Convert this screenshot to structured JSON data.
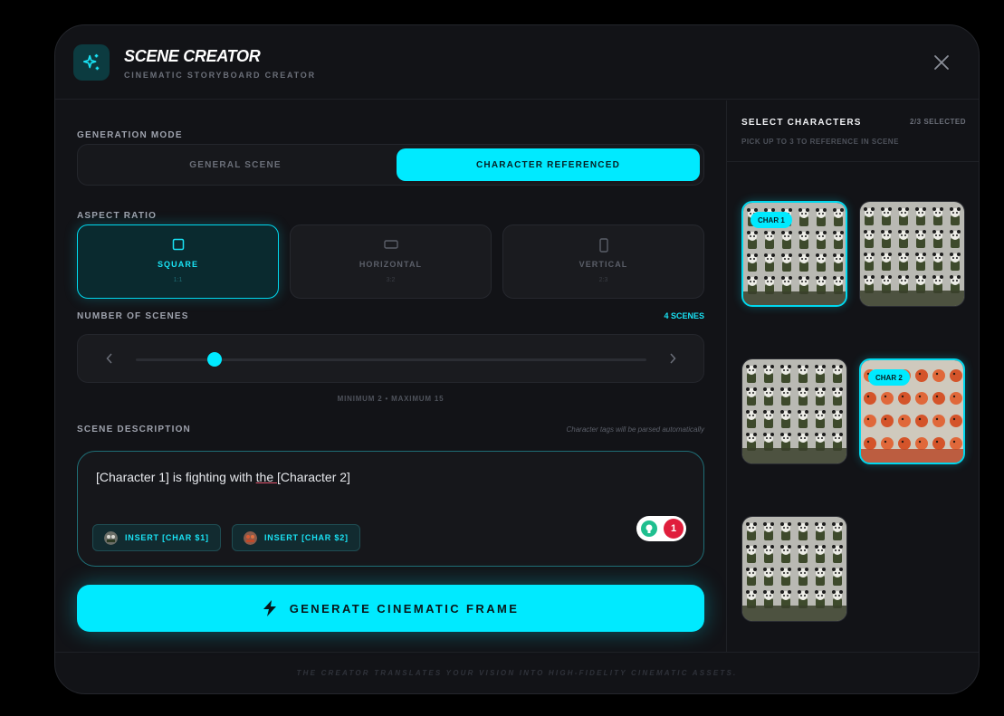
{
  "header": {
    "title": "SCENE CREATOR",
    "subtitle": "CINEMATIC STORYBOARD CREATOR",
    "logo_icon": "sparkles-icon",
    "close_icon": "close-icon"
  },
  "generation_mode": {
    "label": "GENERATION MODE",
    "options": [
      "GENERAL SCENE",
      "CHARACTER REFERENCED"
    ],
    "selected": "CHARACTER REFERENCED"
  },
  "aspect_ratio": {
    "label": "ASPECT RATIO",
    "options": [
      {
        "label": "SQUARE",
        "ratio": "1:1",
        "icon": "square-icon",
        "active": true
      },
      {
        "label": "HORIZONTAL",
        "ratio": "3:2",
        "icon": "horizontal-rect-icon",
        "active": false
      },
      {
        "label": "VERTICAL",
        "ratio": "2:3",
        "icon": "vertical-rect-icon",
        "active": false
      }
    ]
  },
  "scenes": {
    "label": "NUMBER OF SCENES",
    "count_label": "4 SCENES",
    "value": 4,
    "min": 2,
    "max": 15,
    "range_text": "MINIMUM 2 • MAXIMUM 15"
  },
  "description": {
    "label": "SCENE DESCRIPTION",
    "hint": "Character tags will be parsed automatically",
    "text_before": "[Character 1] is fighting with ",
    "text_underlined": "the ",
    "text_after": " [Character 2]",
    "insert_buttons": [
      "INSERT [CHAR $1]",
      "INSERT [CHAR $2]"
    ],
    "grammar_count": "1"
  },
  "generate_button": {
    "label": "GENERATE CINEMATIC FRAME",
    "icon": "lightning-icon"
  },
  "characters": {
    "title": "SELECT CHARACTERS",
    "selected_count": "2/3 SELECTED",
    "subtitle": "PICK UP TO 3 TO REFERENCE IN SCENE",
    "items": [
      {
        "badge": "CHAR 1",
        "selected": true,
        "theme": "panda"
      },
      {
        "badge": "",
        "selected": false,
        "theme": "panda"
      },
      {
        "badge": "",
        "selected": false,
        "theme": "panda"
      },
      {
        "badge": "CHAR 2",
        "selected": true,
        "theme": "dragon"
      },
      {
        "badge": "",
        "selected": false,
        "theme": "panda"
      }
    ]
  },
  "footer": {
    "text": "THE CREATOR TRANSLATES YOUR VISION INTO HIGH-FIDELITY CINEMATIC ASSETS."
  },
  "colors": {
    "accent": "#00eaff",
    "background": "#121317",
    "alert": "#e01e3c"
  }
}
